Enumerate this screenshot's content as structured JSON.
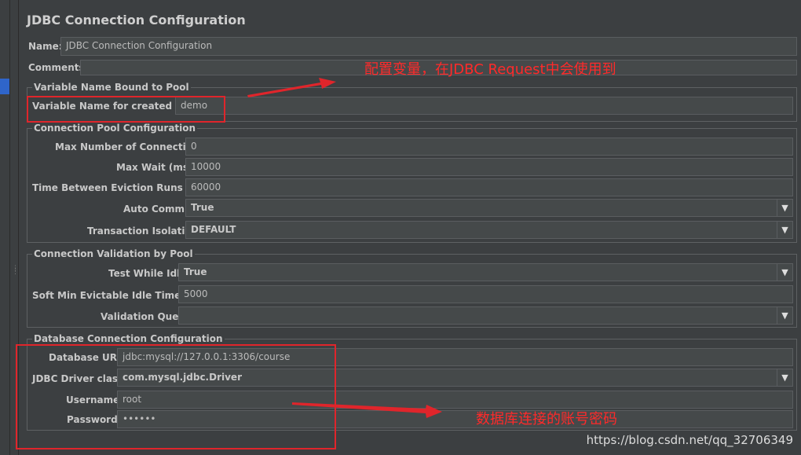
{
  "title": "JDBC Connection Configuration",
  "name_row": {
    "label": "Name:",
    "value": "JDBC Connection Configuration"
  },
  "comments_row": {
    "label": "Comments:",
    "value": ""
  },
  "variable_group": {
    "title": "Variable Name Bound to Pool",
    "var_label": "Variable Name for created pool:",
    "var_value": "demo"
  },
  "pool_group": {
    "title": "Connection Pool Configuration",
    "max_connections_label": "Max Number of Connections:",
    "max_connections_value": "0",
    "max_wait_label": "Max Wait (ms):",
    "max_wait_value": "10000",
    "eviction_label": "Time Between Eviction Runs (ms):",
    "eviction_value": "60000",
    "auto_commit_label": "Auto Commit:",
    "auto_commit_value": "True",
    "isolation_label": "Transaction Isolation:",
    "isolation_value": "DEFAULT"
  },
  "validation_group": {
    "title": "Connection Validation by Pool",
    "test_idle_label": "Test While Idle:",
    "test_idle_value": "True",
    "soft_min_label": "Soft Min Evictable Idle Time(ms):",
    "soft_min_value": "5000",
    "query_label": "Validation Query:",
    "query_value": ""
  },
  "db_group": {
    "title": "Database Connection Configuration",
    "url_label": "Database URL:",
    "url_value": "jdbc:mysql://127.0.0.1:3306/course",
    "driver_label": "JDBC Driver class:",
    "driver_value": "com.mysql.jdbc.Driver",
    "username_label": "Username:",
    "username_value": "root",
    "password_label": "Password:",
    "password_value": "••••••"
  },
  "annotations": {
    "variable_note": "配置变量，在JDBC Request中会使用到",
    "account_note": "数据库连接的账号密码"
  },
  "watermark": "https://blog.csdn.net/qq_32706349",
  "icons": {
    "combo_arrow": "▼"
  },
  "colors": {
    "background": "#3c3f41",
    "annotation_red": "#e0252b",
    "field_bg": "#45494a"
  }
}
